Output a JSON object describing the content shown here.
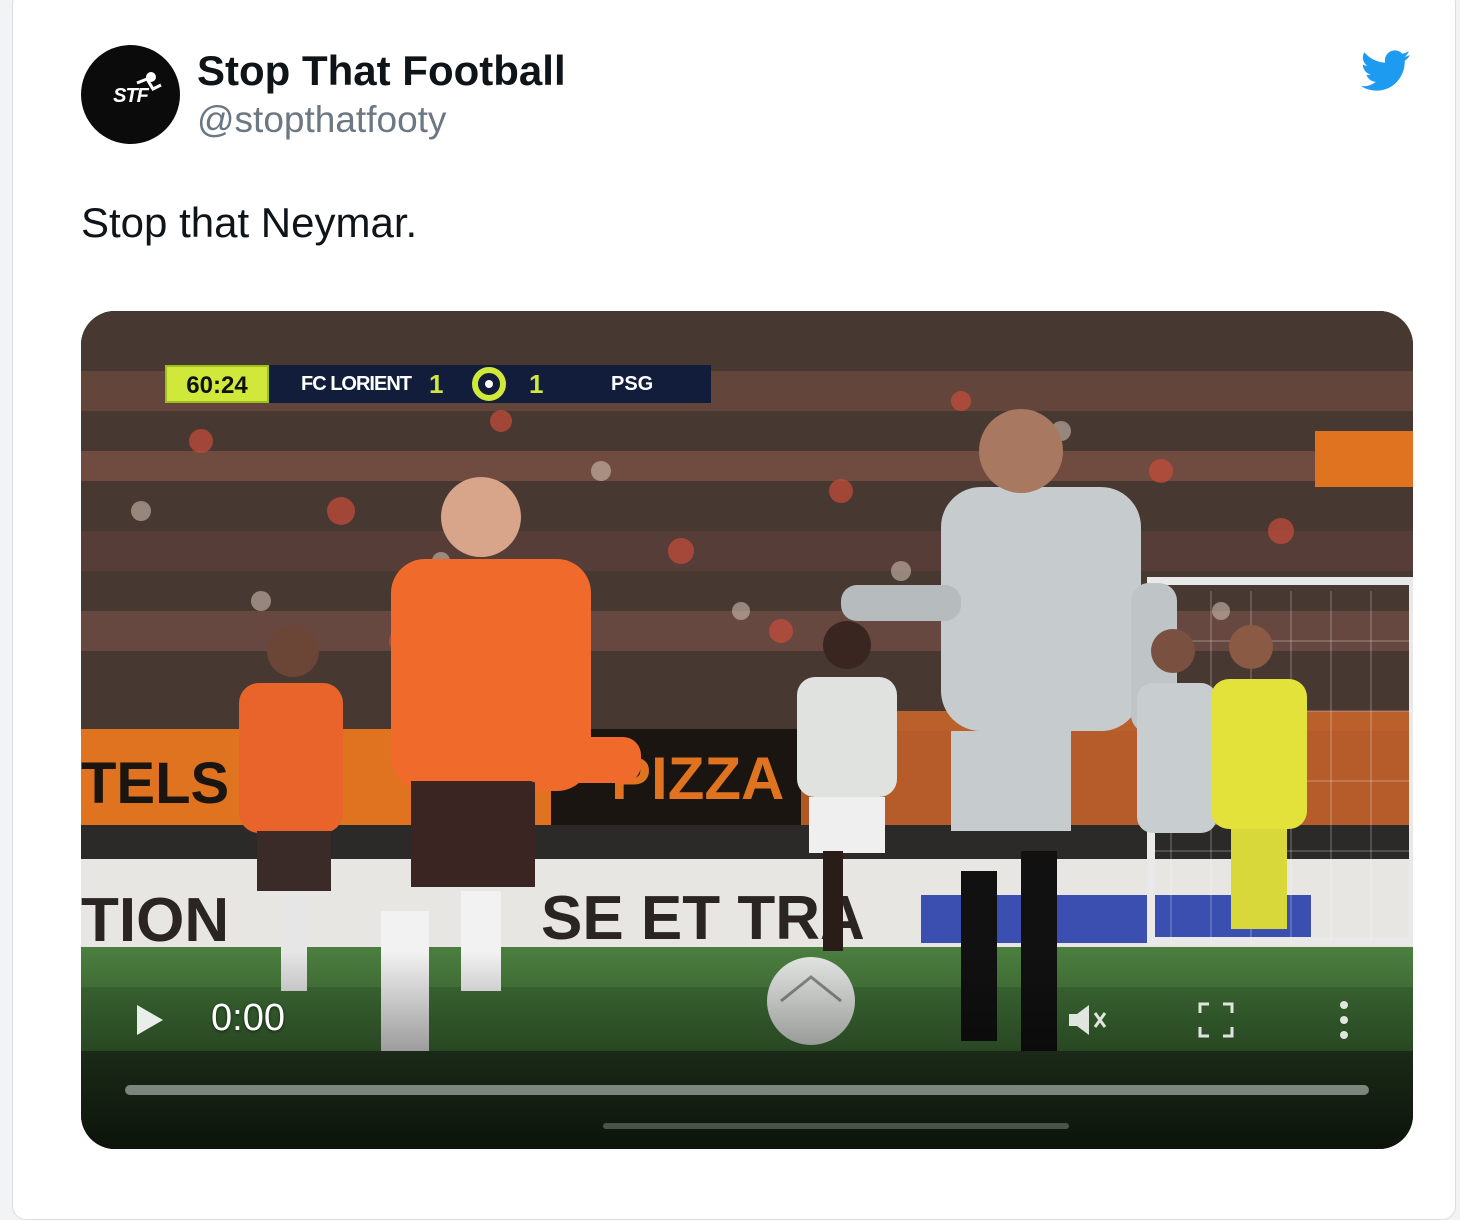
{
  "tweet": {
    "author": {
      "display_name": "Stop That Football",
      "handle": "@stopthatfooty",
      "avatar_text": "STF"
    },
    "platform_icon": "twitter-bird-icon",
    "text": "Stop that Neymar."
  },
  "video": {
    "scorebug": {
      "clock": "60:24",
      "home_team": "FC LORIENT",
      "home_score": "1",
      "away_score": "1",
      "away_team": "PSG"
    },
    "controls": {
      "play_icon": "play-icon",
      "time": "0:00",
      "volume_icon": "volume-muted-icon",
      "fullscreen_icon": "fullscreen-icon",
      "more_icon": "more-vertical-icon",
      "progress": 0
    }
  },
  "colors": {
    "twitter_blue": "#1d9bf0",
    "text_primary": "#0f1419",
    "text_secondary": "#6b7782",
    "scorebug_accent": "#cfe83a"
  }
}
